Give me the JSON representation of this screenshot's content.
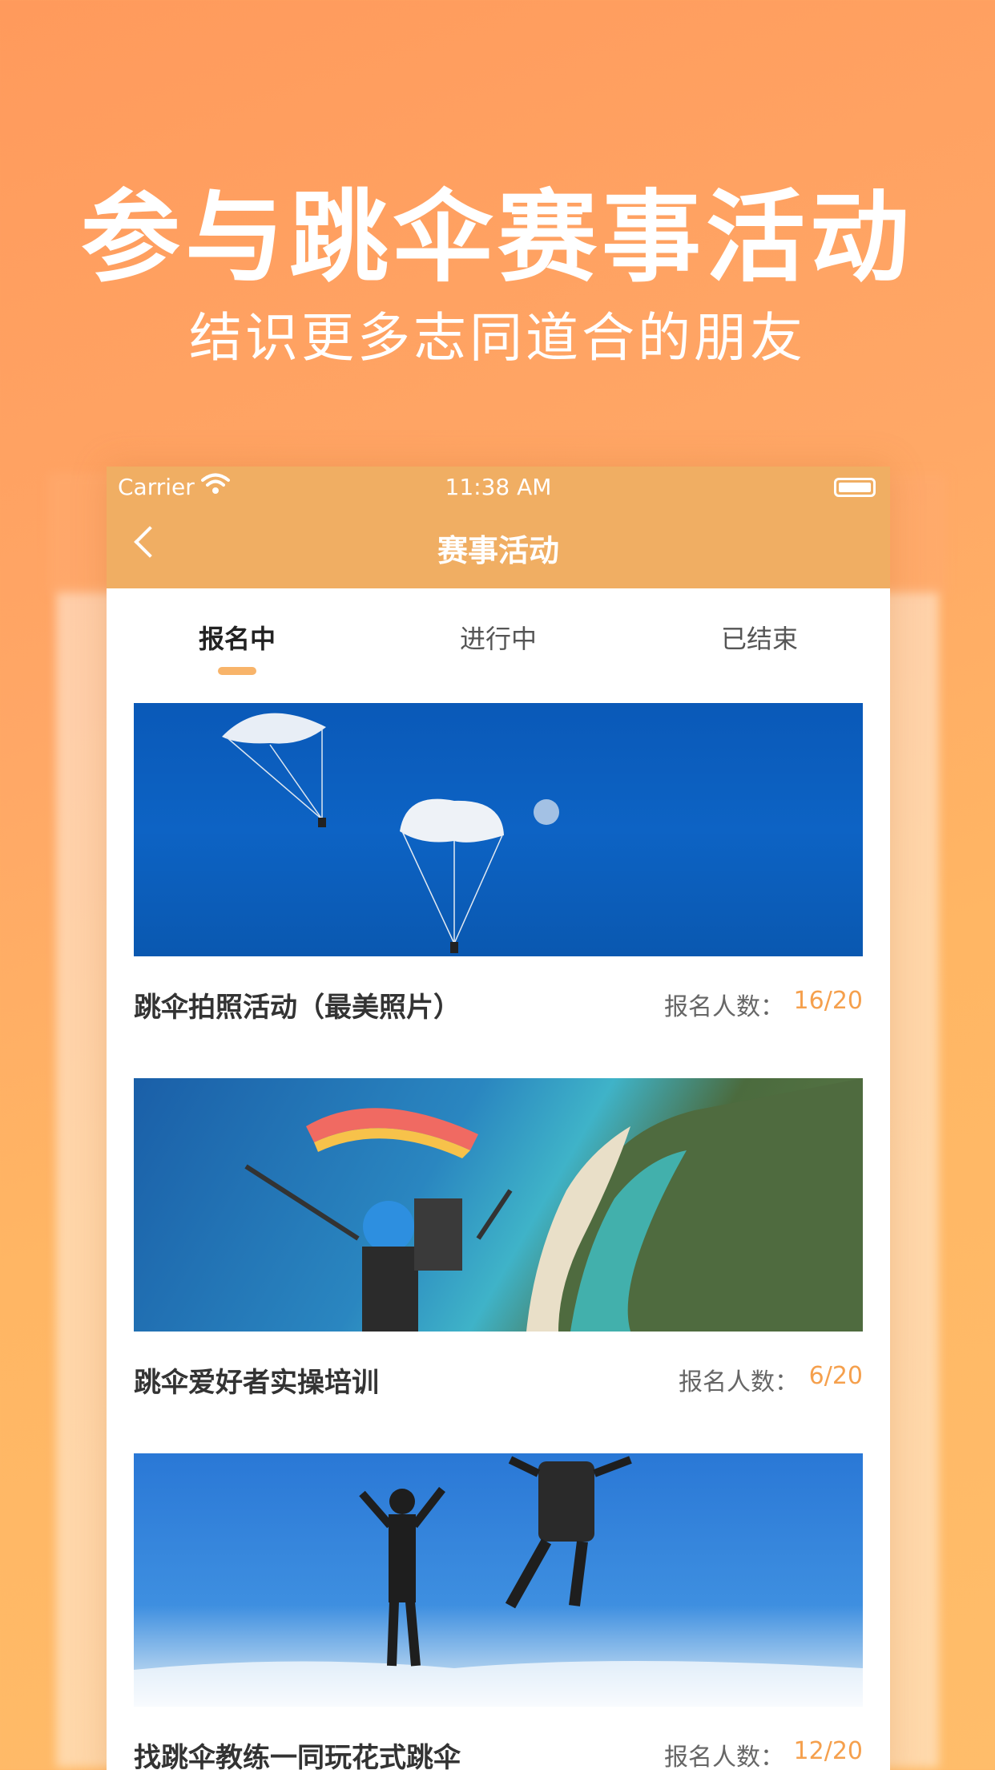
{
  "hero": {
    "title": "参与跳伞赛事活动",
    "subtitle": "结识更多志同道合的朋友"
  },
  "status_bar": {
    "carrier": "Carrier",
    "time": "11:38 AM"
  },
  "navbar": {
    "title": "赛事活动"
  },
  "tabs": [
    {
      "label": "报名中",
      "active": true
    },
    {
      "label": "进行中",
      "active": false
    },
    {
      "label": "已结束",
      "active": false
    }
  ],
  "events": [
    {
      "title": "跳伞拍照活动（最美照片）",
      "count_label": "报名人数：",
      "count": "16/20",
      "image": "parachutes-blue-sky"
    },
    {
      "title": "跳伞爱好者实操培训",
      "count_label": "报名人数：",
      "count": "6/20",
      "image": "paraglider-over-coast"
    },
    {
      "title": "找跳伞教练一同玩花式跳伞",
      "count_label": "报名人数：",
      "count": "12/20",
      "image": "skydivers-freefall"
    }
  ],
  "colors": {
    "accent": "#f0ae63",
    "count": "#f5a04d"
  }
}
